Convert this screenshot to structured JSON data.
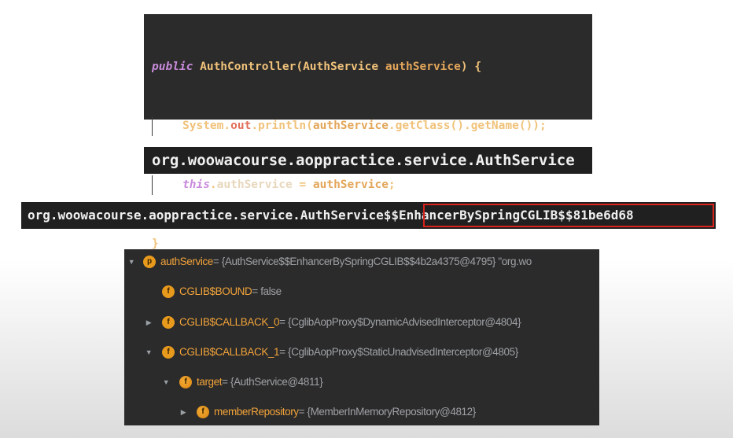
{
  "code": {
    "line1": {
      "kw": "public",
      "ctor": " AuthController(",
      "type": "AuthService",
      "sp": " ",
      "param": "authService",
      "rest": ") {"
    },
    "line2": {
      "sys": "System.",
      "out": "out",
      "dot1": ".",
      "println": "println",
      "open": "(",
      "arg": "authService",
      "dot2": ".",
      "getClass": "getClass",
      "mid": "().",
      "getName": "getName",
      "close": "());"
    },
    "line3": {
      "this": "this",
      "dot": ".",
      "field": "authService",
      "eq": " = ",
      "val": "authService",
      "semi": ";"
    },
    "line4": {
      "brace": "}"
    }
  },
  "output_short": "org.woowacourse.aoppractice.service.AuthService",
  "output_long": {
    "base": "org.woowacourse.aoppractice.service.AuthService",
    "suffix": "$$EnhancerBySpringCGLIB$$81be6d68"
  },
  "debugger": {
    "rows": [
      {
        "arrow": "▼",
        "badge": "p",
        "name": "authService",
        "value": " = {AuthService$$EnhancerBySpringCGLIB$$4b2a4375@4795} \"org.wo"
      },
      {
        "arrow": "",
        "badge": "f",
        "name": "CGLIB$BOUND",
        "value": " = false"
      },
      {
        "arrow": "▶",
        "badge": "f",
        "name": "CGLIB$CALLBACK_0",
        "value": " = {CglibAopProxy$DynamicAdvisedInterceptor@4804}"
      },
      {
        "arrow": "▼",
        "badge": "f",
        "name": "CGLIB$CALLBACK_1",
        "value": " = {CglibAopProxy$StaticUnadvisedInterceptor@4805}"
      },
      {
        "arrow": "▼",
        "badge": "f",
        "name": "target",
        "value": " = {AuthService@4811}"
      },
      {
        "arrow": "▶",
        "badge": "f",
        "name": "memberRepository",
        "value": " = {MemberInMemoryRepository@4812}"
      }
    ]
  }
}
